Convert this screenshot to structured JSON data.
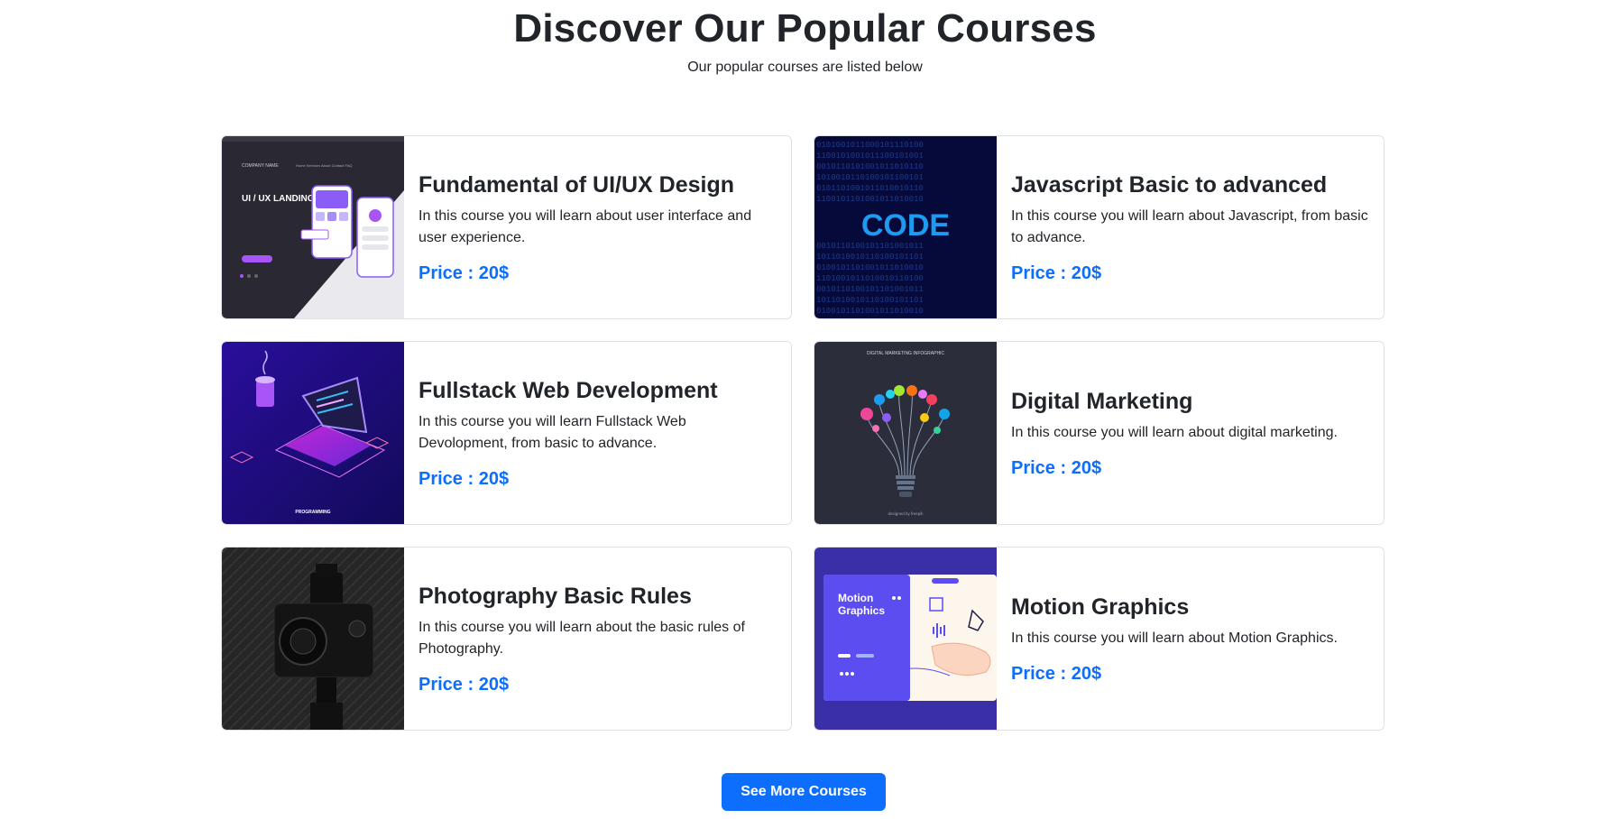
{
  "header": {
    "title": "Discover Our Popular Courses",
    "subtitle": "Our popular courses are listed below"
  },
  "courses": [
    {
      "title": "Fundamental of UI/UX Design",
      "description": "In this course you will learn about user interface and user experience.",
      "price": "Price : 20$",
      "image_label": "UI / UX LANDING PAGE"
    },
    {
      "title": "Javascript Basic to advanced",
      "description": "In this course you will learn about Javascript, from basic to advance.",
      "price": "Price : 20$",
      "image_label": "CODE"
    },
    {
      "title": "Fullstack Web Development",
      "description": "In this course you will learn Fullstack Web Devolopment, from basic to advance.",
      "price": "Price : 20$",
      "image_label": "PROGRAMMING"
    },
    {
      "title": "Digital Marketing",
      "description": "In this course you will learn about digital marketing.",
      "price": "Price : 20$",
      "image_label": "DIGITAL MARKETING INFOGRAPHIC"
    },
    {
      "title": "Photography Basic Rules",
      "description": "In this course you will learn about the basic rules of Photography.",
      "price": "Price : 20$",
      "image_label": ""
    },
    {
      "title": "Motion Graphics",
      "description": "In this course you will learn about Motion Graphics.",
      "price": "Price : 20$",
      "image_label": "Motion Graphics"
    }
  ],
  "see_more_label": "See More Courses",
  "colors": {
    "accent": "#0d6efd",
    "text": "#212529",
    "border": "#dee2e6"
  }
}
